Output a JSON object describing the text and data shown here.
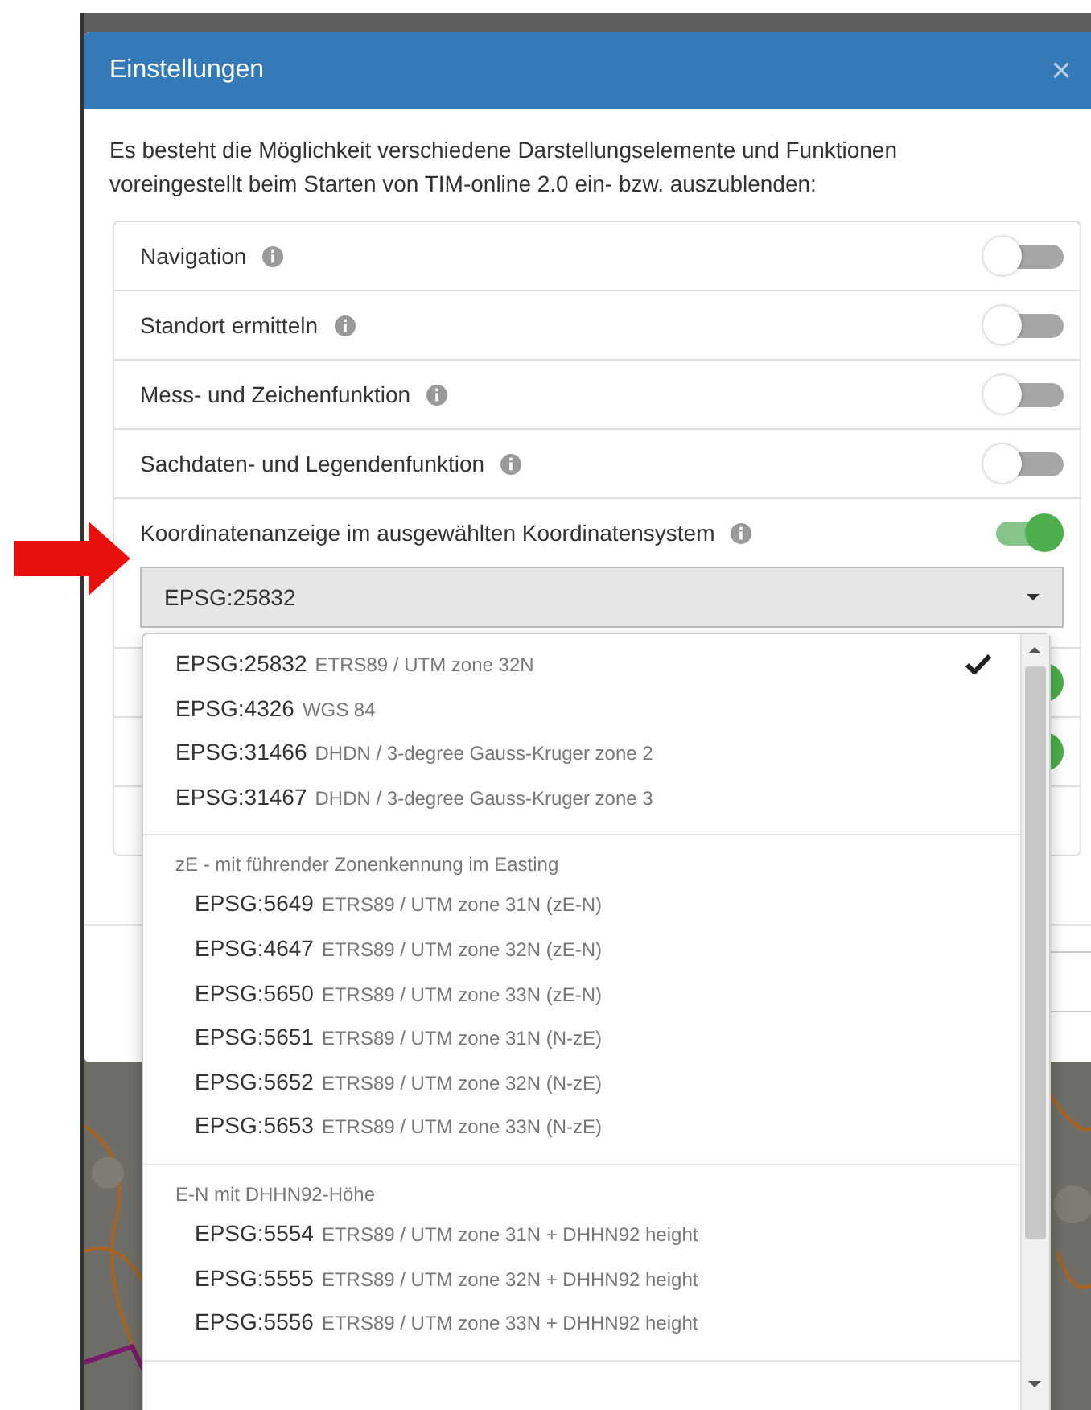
{
  "dialog": {
    "title": "Einstellungen",
    "close": "×"
  },
  "intro": "Es besteht die Möglichkeit verschiedene Darstellungselemente und Funktionen voreingestellt beim Starten von TIM-online 2.0 ein- bzw. auszublenden:",
  "settings": [
    {
      "label": "Navigation",
      "on": false
    },
    {
      "label": "Standort ermitteln",
      "on": false
    },
    {
      "label": "Mess- und Zeichenfunktion",
      "on": false
    },
    {
      "label": "Sachdaten- und Legendenfunktion",
      "on": false
    },
    {
      "label": "Koordinatenanzeige im ausgewählten Koordinatensystem",
      "on": true,
      "select": {
        "value": "EPSG:25832"
      }
    }
  ],
  "covered_rows": [
    {
      "on": true
    },
    {
      "on": true
    }
  ],
  "dropdown": {
    "groups": [
      {
        "items": [
          {
            "code": "EPSG:25832",
            "name": "ETRS89 / UTM zone 32N",
            "selected": true
          },
          {
            "code": "EPSG:4326",
            "name": "WGS 84",
            "selected": false
          },
          {
            "code": "EPSG:31466",
            "name": "DHDN / 3-degree Gauss-Kruger zone 2",
            "selected": false
          },
          {
            "code": "EPSG:31467",
            "name": "DHDN / 3-degree Gauss-Kruger zone 3",
            "selected": false
          }
        ]
      },
      {
        "header": "zE - mit führender Zonenkennung im Easting",
        "items": [
          {
            "code": "EPSG:5649",
            "name": "ETRS89 / UTM zone 31N (zE-N)",
            "selected": false
          },
          {
            "code": "EPSG:4647",
            "name": "ETRS89 / UTM zone 32N (zE-N)",
            "selected": false
          },
          {
            "code": "EPSG:5650",
            "name": "ETRS89 / UTM zone 33N (zE-N)",
            "selected": false
          },
          {
            "code": "EPSG:5651",
            "name": "ETRS89 / UTM zone 31N (N-zE)",
            "selected": false
          },
          {
            "code": "EPSG:5652",
            "name": "ETRS89 / UTM zone 32N (N-zE)",
            "selected": false
          },
          {
            "code": "EPSG:5653",
            "name": "ETRS89 / UTM zone 33N (N-zE)",
            "selected": false
          }
        ]
      },
      {
        "header": "E-N mit DHHN92-Höhe",
        "items": [
          {
            "code": "EPSG:5554",
            "name": "ETRS89 / UTM zone 31N + DHHN92 height",
            "selected": false
          },
          {
            "code": "EPSG:5555",
            "name": "ETRS89 / UTM zone 32N + DHHN92 height",
            "selected": false
          },
          {
            "code": "EPSG:5556",
            "name": "ETRS89 / UTM zone 33N + DHHN92 height",
            "selected": false
          }
        ]
      }
    ]
  }
}
